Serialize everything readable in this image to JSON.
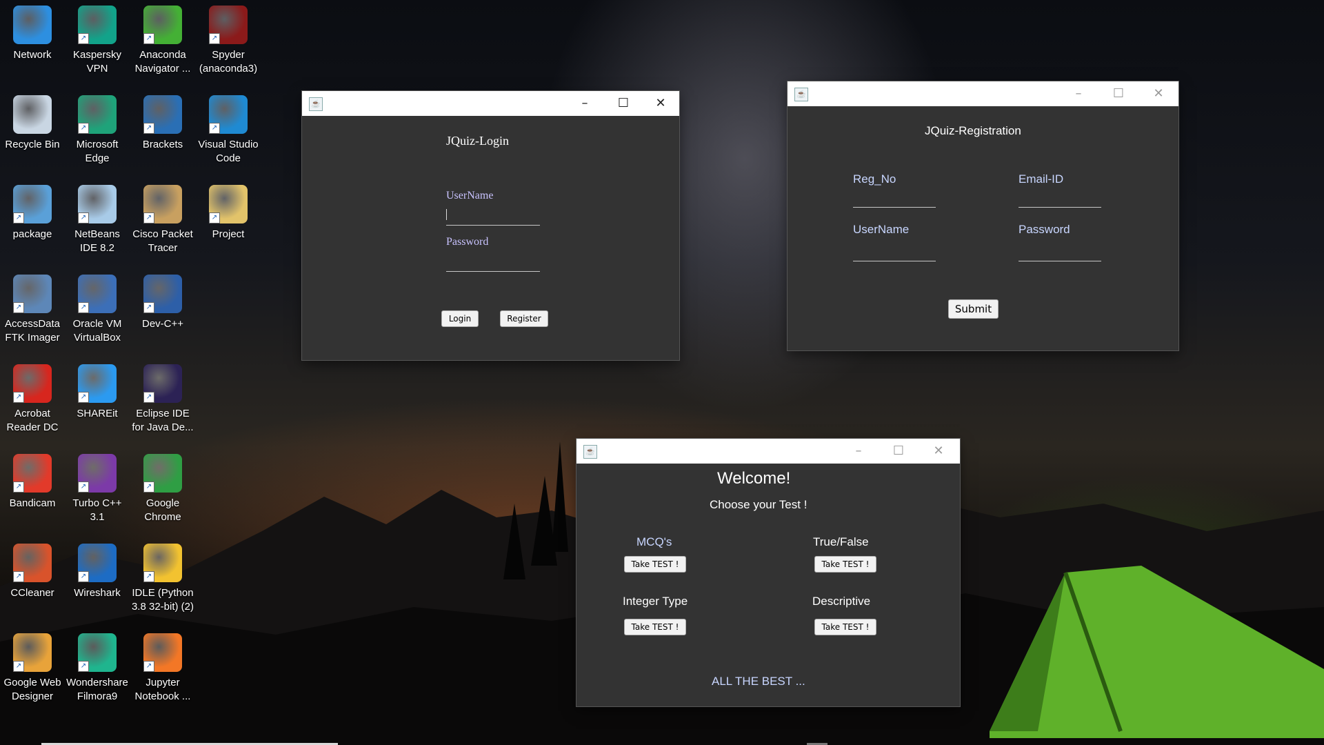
{
  "desktop": {
    "icons": [
      {
        "label": "Network",
        "icon": "network-icon",
        "color": "#2d8fe0"
      },
      {
        "label": "Kaspersky VPN",
        "icon": "kaspersky-vpn-icon",
        "color": "#12a38a"
      },
      {
        "label": "Anaconda Navigator ...",
        "icon": "anaconda-icon",
        "color": "#44b035"
      },
      {
        "label": "Spyder (anaconda3)",
        "icon": "spyder-icon",
        "color": "#8b1a1a"
      },
      {
        "label": "Recycle Bin",
        "icon": "recycle-bin-icon",
        "color": "#c9d6e3"
      },
      {
        "label": "Microsoft Edge",
        "icon": "edge-icon",
        "color": "#1fa37a"
      },
      {
        "label": "Brackets",
        "icon": "brackets-icon",
        "color": "#2a6fb5"
      },
      {
        "label": "Visual Studio Code",
        "icon": "vscode-icon",
        "color": "#1f8ad2"
      },
      {
        "label": "package",
        "icon": "package-icon",
        "color": "#5aa0d8"
      },
      {
        "label": "NetBeans IDE 8.2",
        "icon": "netbeans-icon",
        "color": "#a8cbe8"
      },
      {
        "label": "Cisco Packet Tracer",
        "icon": "packet-tracer-icon",
        "color": "#c8a060"
      },
      {
        "label": "Project",
        "icon": "project-icon",
        "color": "#e2c36a"
      },
      {
        "label": "AccessData FTK Imager",
        "icon": "ftk-imager-icon",
        "color": "#5d87b8"
      },
      {
        "label": "Oracle VM VirtualBox",
        "icon": "virtualbox-icon",
        "color": "#3c6fb8"
      },
      {
        "label": "Dev-C++",
        "icon": "devcpp-icon",
        "color": "#2d5fa8"
      },
      {
        "label": "Acrobat Reader DC",
        "icon": "acrobat-icon",
        "color": "#d7261e"
      },
      {
        "label": "SHAREit",
        "icon": "shareit-icon",
        "color": "#2b9af0"
      },
      {
        "label": "Eclipse IDE for Java De...",
        "icon": "eclipse-icon",
        "color": "#2c2255"
      },
      {
        "label": "Bandicam",
        "icon": "bandicam-icon",
        "color": "#e23a2a"
      },
      {
        "label": "Turbo C++ 3.1",
        "icon": "turbo-cpp-icon",
        "color": "#7c3aa8"
      },
      {
        "label": "Google Chrome",
        "icon": "chrome-icon",
        "color": "#2f9e44"
      },
      {
        "label": "CCleaner",
        "icon": "ccleaner-icon",
        "color": "#d9532b"
      },
      {
        "label": "Wireshark",
        "icon": "wireshark-icon",
        "color": "#1d6cc4"
      },
      {
        "label": "IDLE (Python 3.8 32-bit) (2)",
        "icon": "python-idle-icon",
        "color": "#f2c230"
      },
      {
        "label": "Google Web Designer",
        "icon": "google-web-designer-icon",
        "color": "#e8a33a"
      },
      {
        "label": "Wondershare Filmora9",
        "icon": "filmora-icon",
        "color": "#1fb58e"
      },
      {
        "label": "Jupyter Notebook ...",
        "icon": "jupyter-icon",
        "color": "#f37726"
      }
    ]
  },
  "login_window": {
    "title": "JQuiz-Login",
    "username_label": "UserName",
    "password_label": "Password",
    "login_button": "Login",
    "register_button": "Register",
    "minimize": "–",
    "maximize": "☐",
    "close": "✕"
  },
  "registration_window": {
    "title": "JQuiz-Registration",
    "reg_no_label": "Reg_No",
    "email_label": "Email-ID",
    "username_label": "UserName",
    "password_label": "Password",
    "submit_button": "Submit",
    "minimize": "–",
    "maximize": "☐",
    "close": "✕"
  },
  "welcome_window": {
    "heading": "Welcome!",
    "subheading": "Choose your Test !",
    "tests": [
      {
        "label": "MCQ's",
        "button": "Take TEST !"
      },
      {
        "label": "True/False",
        "button": "Take TEST !"
      },
      {
        "label": "Integer Type",
        "button": "Take TEST !"
      },
      {
        "label": "Descriptive",
        "button": "Take TEST !"
      }
    ],
    "footer": "ALL THE BEST ...",
    "minimize": "–",
    "maximize": "☐",
    "close": "✕"
  },
  "colors": {
    "window_bg": "#333333",
    "label_lavender": "#c9c3ff",
    "label_blue": "#c8d6ff"
  }
}
